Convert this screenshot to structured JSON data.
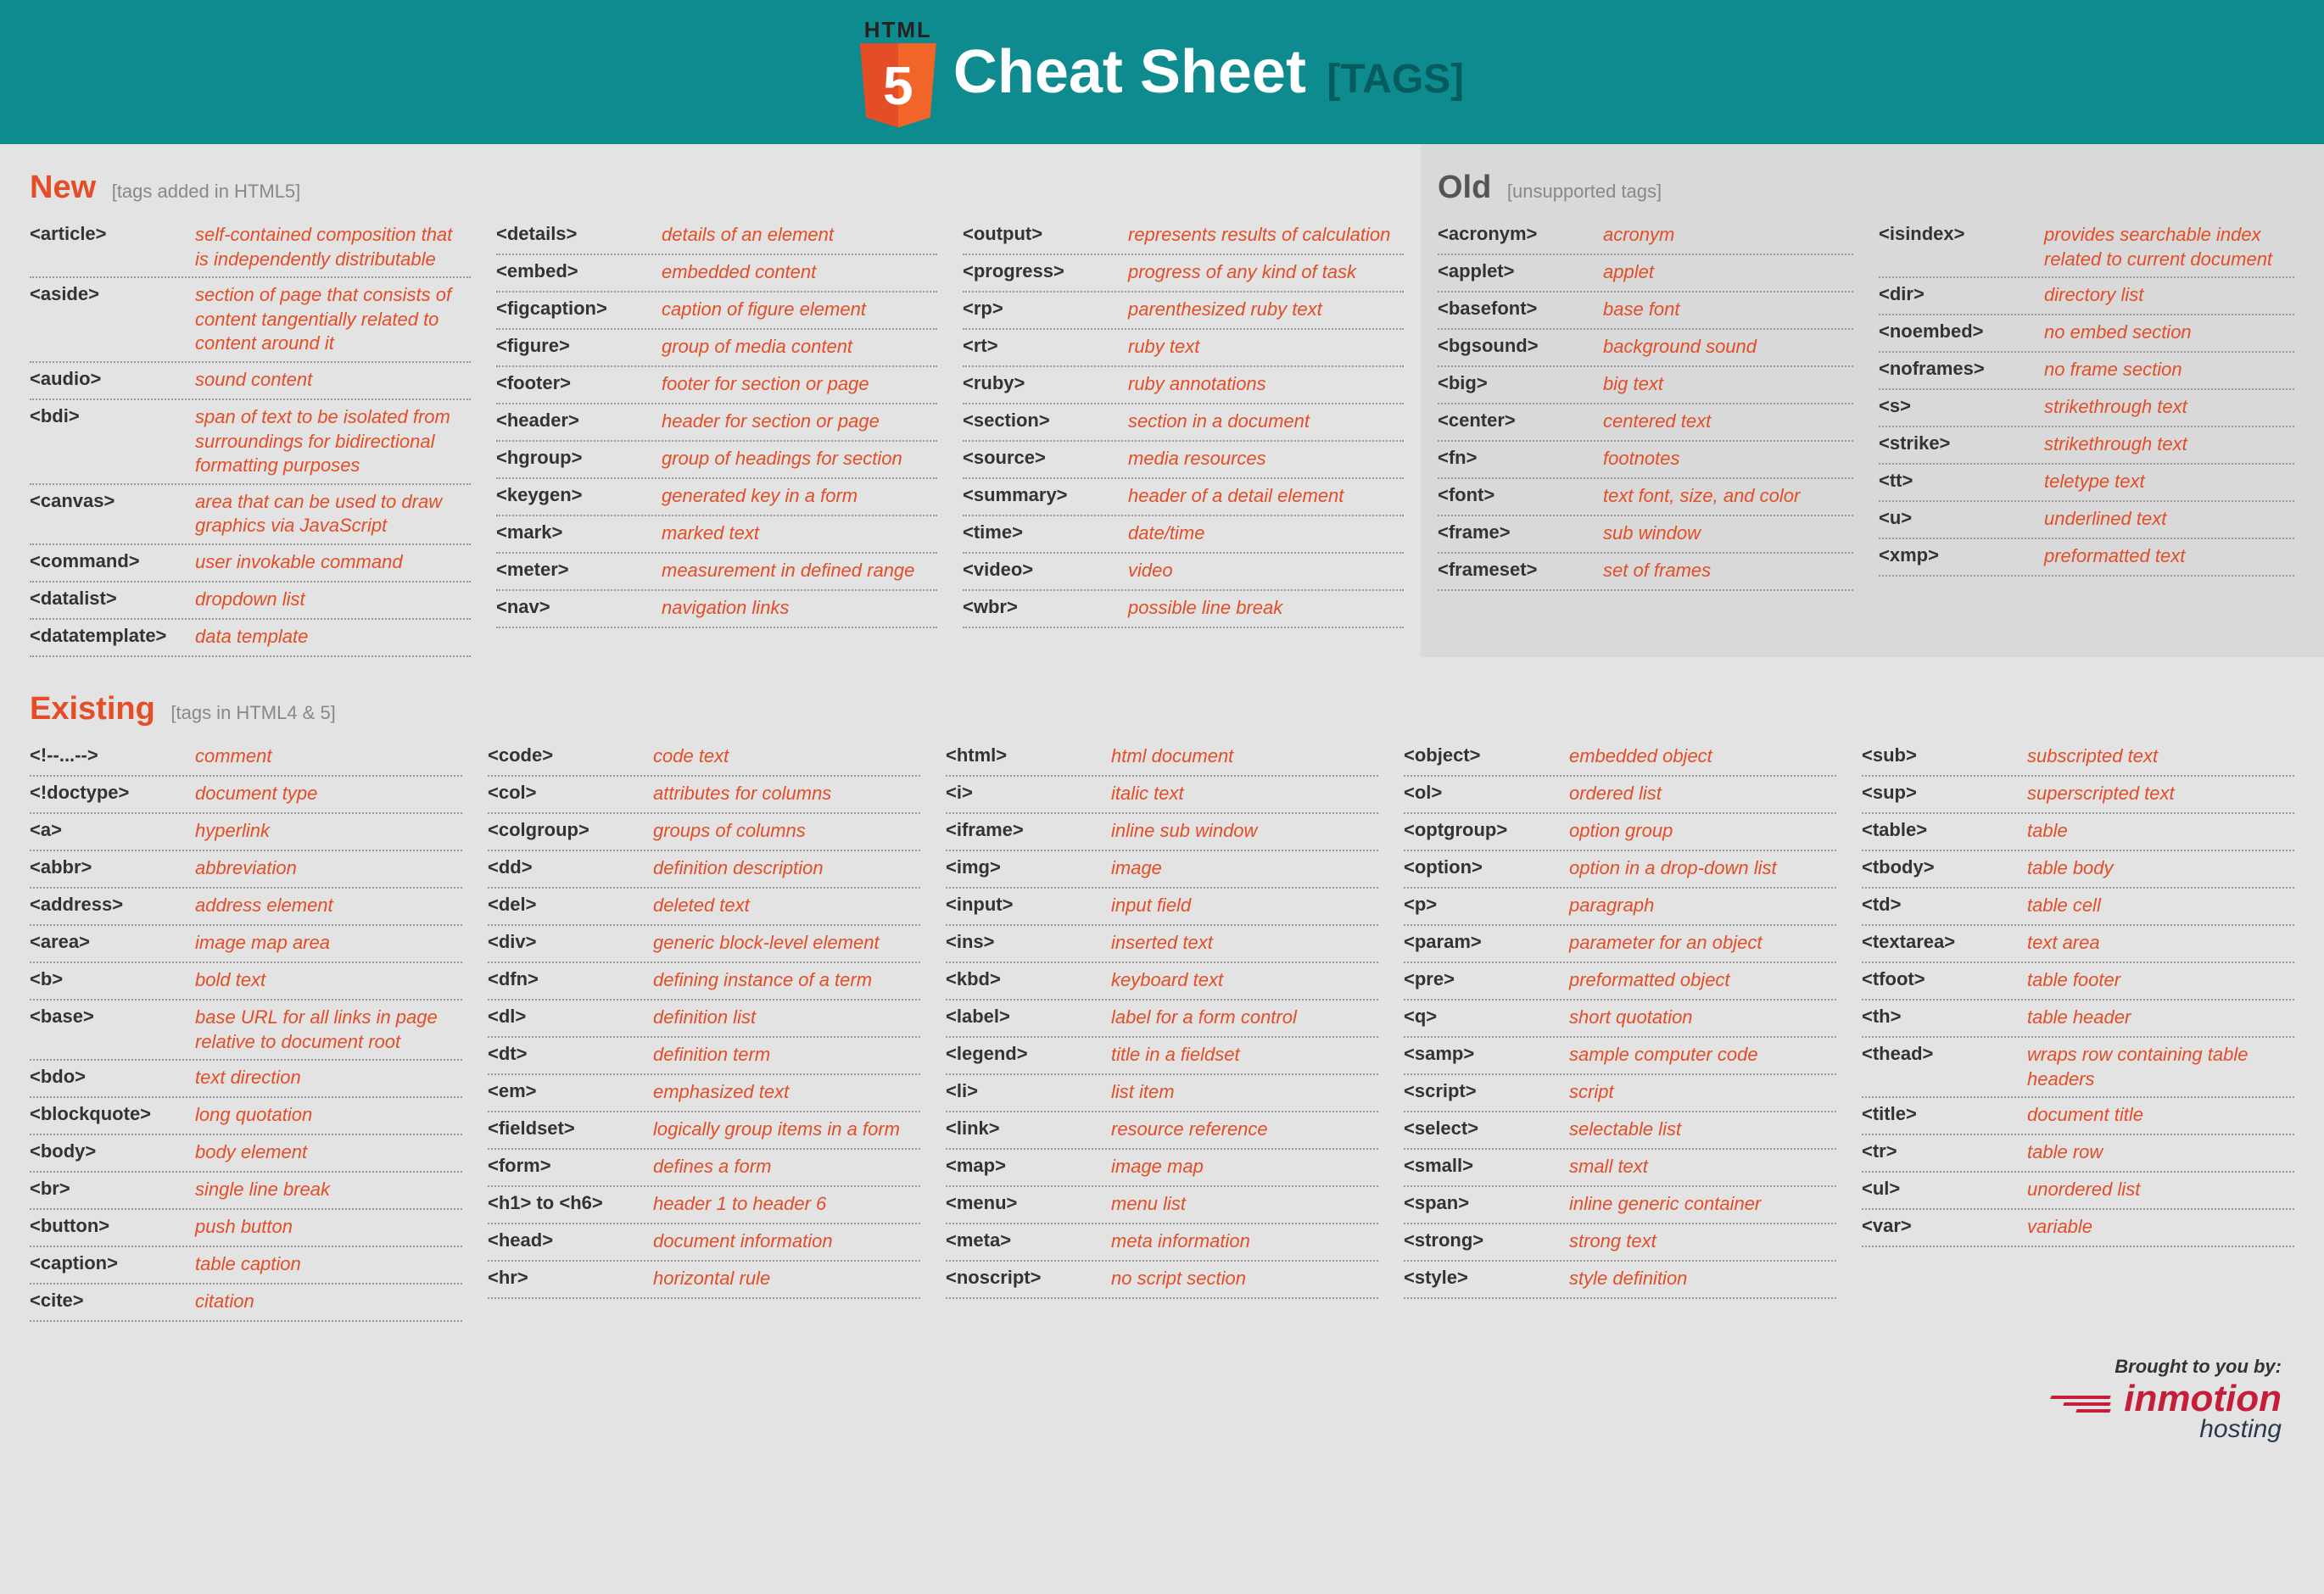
{
  "header": {
    "logo_html": "HTML",
    "logo_5": "5",
    "title": "Cheat Sheet",
    "subtitle": "[TAGS]"
  },
  "sections": {
    "new": {
      "title": "New",
      "sub": "[tags added in HTML5]"
    },
    "old": {
      "title": "Old",
      "sub": "[unsupported tags]"
    },
    "existing": {
      "title": "Existing",
      "sub": "[tags in HTML4 & 5]"
    }
  },
  "new_cols": [
    [
      {
        "tag": "<article>",
        "desc": "self-contained composition that is independently distributable"
      },
      {
        "tag": "<aside>",
        "desc": "section of page that consists of content tangentially related to content around it"
      },
      {
        "tag": "<audio>",
        "desc": "sound content"
      },
      {
        "tag": "<bdi>",
        "desc": "span of text to be isolated from surroundings for bidirectional formatting purposes"
      },
      {
        "tag": "<canvas>",
        "desc": "area that can be used to draw graphics via JavaScript"
      },
      {
        "tag": "<command>",
        "desc": "user invokable command"
      },
      {
        "tag": "<datalist>",
        "desc": "dropdown list"
      },
      {
        "tag": "<datatemplate>",
        "desc": "data template"
      }
    ],
    [
      {
        "tag": "<details>",
        "desc": "details of an element"
      },
      {
        "tag": "<embed>",
        "desc": "embedded content"
      },
      {
        "tag": "<figcaption>",
        "desc": "caption of figure element"
      },
      {
        "tag": "<figure>",
        "desc": "group of media content"
      },
      {
        "tag": "<footer>",
        "desc": "footer for section or page"
      },
      {
        "tag": "<header>",
        "desc": "header for section or page"
      },
      {
        "tag": "<hgroup>",
        "desc": "group of headings for section"
      },
      {
        "tag": "<keygen>",
        "desc": "generated key in a form"
      },
      {
        "tag": "<mark>",
        "desc": "marked text"
      },
      {
        "tag": "<meter>",
        "desc": "measurement in defined range"
      },
      {
        "tag": "<nav>",
        "desc": "navigation links"
      }
    ],
    [
      {
        "tag": "<output>",
        "desc": "represents results of calculation"
      },
      {
        "tag": "<progress>",
        "desc": "progress of any kind of task"
      },
      {
        "tag": "<rp>",
        "desc": "parenthesized ruby text"
      },
      {
        "tag": "<rt>",
        "desc": "ruby text"
      },
      {
        "tag": "<ruby>",
        "desc": "ruby annotations"
      },
      {
        "tag": "<section>",
        "desc": "section in a document"
      },
      {
        "tag": "<source>",
        "desc": "media resources"
      },
      {
        "tag": "<summary>",
        "desc": "header of a detail element"
      },
      {
        "tag": "<time>",
        "desc": "date/time"
      },
      {
        "tag": "<video>",
        "desc": "video"
      },
      {
        "tag": "<wbr>",
        "desc": "possible line break"
      }
    ]
  ],
  "old_cols": [
    [
      {
        "tag": "<acronym>",
        "desc": "acronym"
      },
      {
        "tag": "<applet>",
        "desc": "applet"
      },
      {
        "tag": "<basefont>",
        "desc": "base font"
      },
      {
        "tag": "<bgsound>",
        "desc": "background sound"
      },
      {
        "tag": "<big>",
        "desc": "big text"
      },
      {
        "tag": "<center>",
        "desc": "centered text"
      },
      {
        "tag": "<fn>",
        "desc": "footnotes"
      },
      {
        "tag": "<font>",
        "desc": "text font, size, and color"
      },
      {
        "tag": "<frame>",
        "desc": "sub window"
      },
      {
        "tag": "<frameset>",
        "desc": "set of frames"
      }
    ],
    [
      {
        "tag": "<isindex>",
        "desc": "provides searchable index related to current document"
      },
      {
        "tag": "<dir>",
        "desc": "directory list"
      },
      {
        "tag": "<noembed>",
        "desc": "no embed section"
      },
      {
        "tag": "<noframes>",
        "desc": "no frame section"
      },
      {
        "tag": "<s>",
        "desc": "strikethrough text"
      },
      {
        "tag": "<strike>",
        "desc": "strikethrough text"
      },
      {
        "tag": "<tt>",
        "desc": "teletype text"
      },
      {
        "tag": "<u>",
        "desc": "underlined text"
      },
      {
        "tag": "<xmp>",
        "desc": "preformatted text"
      }
    ]
  ],
  "existing_cols": [
    [
      {
        "tag": "<!--...-->",
        "desc": "comment"
      },
      {
        "tag": "<!doctype>",
        "desc": "document type"
      },
      {
        "tag": "<a>",
        "desc": "hyperlink"
      },
      {
        "tag": "<abbr>",
        "desc": "abbreviation"
      },
      {
        "tag": "<address>",
        "desc": "address element"
      },
      {
        "tag": "<area>",
        "desc": "image map area"
      },
      {
        "tag": "<b>",
        "desc": "bold text"
      },
      {
        "tag": "<base>",
        "desc": "base URL for all links in page relative to document root"
      },
      {
        "tag": "<bdo>",
        "desc": "text direction"
      },
      {
        "tag": "<blockquote>",
        "desc": "long quotation"
      },
      {
        "tag": "<body>",
        "desc": "body element"
      },
      {
        "tag": "<br>",
        "desc": "single line break"
      },
      {
        "tag": "<button>",
        "desc": "push button"
      },
      {
        "tag": "<caption>",
        "desc": "table caption"
      },
      {
        "tag": "<cite>",
        "desc": "citation"
      }
    ],
    [
      {
        "tag": "<code>",
        "desc": "code text"
      },
      {
        "tag": "<col>",
        "desc": "attributes for columns"
      },
      {
        "tag": "<colgroup>",
        "desc": "groups of columns"
      },
      {
        "tag": "<dd>",
        "desc": "definition description"
      },
      {
        "tag": "<del>",
        "desc": "deleted text"
      },
      {
        "tag": "<div>",
        "desc": "generic block-level element"
      },
      {
        "tag": "<dfn>",
        "desc": "defining instance of a term"
      },
      {
        "tag": "<dl>",
        "desc": "definition list"
      },
      {
        "tag": "<dt>",
        "desc": "definition term"
      },
      {
        "tag": "<em>",
        "desc": "emphasized text"
      },
      {
        "tag": "<fieldset>",
        "desc": "logically group items in a form"
      },
      {
        "tag": "<form>",
        "desc": "defines a form"
      },
      {
        "tag": "<h1> to <h6>",
        "desc": "header 1 to header 6"
      },
      {
        "tag": "<head>",
        "desc": "document information"
      },
      {
        "tag": "<hr>",
        "desc": "horizontal rule"
      }
    ],
    [
      {
        "tag": "<html>",
        "desc": "html document"
      },
      {
        "tag": "<i>",
        "desc": "italic text"
      },
      {
        "tag": "<iframe>",
        "desc": "inline sub window"
      },
      {
        "tag": "<img>",
        "desc": "image"
      },
      {
        "tag": "<input>",
        "desc": "input field"
      },
      {
        "tag": "<ins>",
        "desc": "inserted text"
      },
      {
        "tag": "<kbd>",
        "desc": "keyboard text"
      },
      {
        "tag": "<label>",
        "desc": "label for a form control"
      },
      {
        "tag": "<legend>",
        "desc": "title in a fieldset"
      },
      {
        "tag": "<li>",
        "desc": "list item"
      },
      {
        "tag": "<link>",
        "desc": "resource reference"
      },
      {
        "tag": "<map>",
        "desc": "image map"
      },
      {
        "tag": "<menu>",
        "desc": "menu list"
      },
      {
        "tag": "<meta>",
        "desc": "meta information"
      },
      {
        "tag": "<noscript>",
        "desc": "no script section"
      }
    ],
    [
      {
        "tag": "<object>",
        "desc": "embedded object"
      },
      {
        "tag": "<ol>",
        "desc": "ordered list"
      },
      {
        "tag": "<optgroup>",
        "desc": "option group"
      },
      {
        "tag": "<option>",
        "desc": "option in a drop-down list"
      },
      {
        "tag": "<p>",
        "desc": "paragraph"
      },
      {
        "tag": "<param>",
        "desc": "parameter for an object"
      },
      {
        "tag": "<pre>",
        "desc": "preformatted object"
      },
      {
        "tag": "<q>",
        "desc": "short quotation"
      },
      {
        "tag": "<samp>",
        "desc": "sample computer code"
      },
      {
        "tag": "<script>",
        "desc": "script"
      },
      {
        "tag": "<select>",
        "desc": "selectable list"
      },
      {
        "tag": "<small>",
        "desc": "small text"
      },
      {
        "tag": "<span>",
        "desc": "inline generic container"
      },
      {
        "tag": "<strong>",
        "desc": "strong text"
      },
      {
        "tag": "<style>",
        "desc": "style definition"
      }
    ],
    [
      {
        "tag": "<sub>",
        "desc": "subscripted text"
      },
      {
        "tag": "<sup>",
        "desc": "superscripted text"
      },
      {
        "tag": "<table>",
        "desc": "table"
      },
      {
        "tag": "<tbody>",
        "desc": "table body"
      },
      {
        "tag": "<td>",
        "desc": "table cell"
      },
      {
        "tag": "<textarea>",
        "desc": "text area"
      },
      {
        "tag": "<tfoot>",
        "desc": "table footer"
      },
      {
        "tag": "<th>",
        "desc": "table header"
      },
      {
        "tag": "<thead>",
        "desc": "wraps row containing table headers"
      },
      {
        "tag": "<title>",
        "desc": "document title"
      },
      {
        "tag": "<tr>",
        "desc": "table row"
      },
      {
        "tag": "<ul>",
        "desc": "unordered list"
      },
      {
        "tag": "<var>",
        "desc": "variable"
      }
    ]
  ],
  "footer": {
    "brought": "Brought to you by:",
    "brand1": "inmotion",
    "brand2": "hosting"
  }
}
